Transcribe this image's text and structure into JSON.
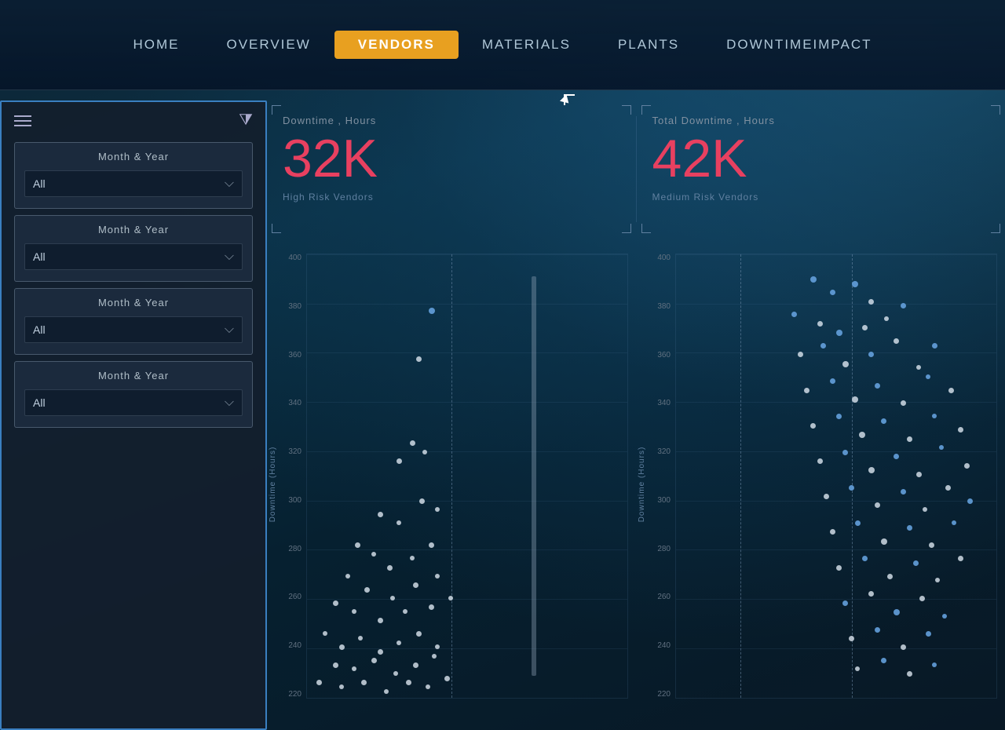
{
  "nav": {
    "items": [
      {
        "label": "Home",
        "active": false
      },
      {
        "label": "Overview",
        "active": false
      },
      {
        "label": "Vendors",
        "active": true
      },
      {
        "label": "Materials",
        "active": false
      },
      {
        "label": "Plants",
        "active": false
      },
      {
        "label": "DowntimeImpact",
        "active": false
      }
    ]
  },
  "sidebar": {
    "filters": [
      {
        "label": "Month & Year",
        "value": "All"
      },
      {
        "label": "Month & Year",
        "value": "All"
      },
      {
        "label": "Month & Year",
        "value": "All"
      },
      {
        "label": "Month & Year",
        "value": "All"
      }
    ]
  },
  "kpi": [
    {
      "label": "Downtime , Hours",
      "value": "32K",
      "sublabel": "High Risk Vendors"
    },
    {
      "label": "Total Downtime , Hours",
      "value": "42K",
      "sublabel": "Medium Risk Vendors"
    }
  ],
  "chart": {
    "y_axis_title": "Downtime (Hours)",
    "y_labels": [
      "400",
      "380",
      "360",
      "340",
      "320",
      "300",
      "280",
      "260",
      "240",
      "220"
    ],
    "placeholder": "scatter"
  },
  "colors": {
    "accent_orange": "#e8a020",
    "accent_red": "#e84060",
    "brand_blue": "#3a7fc0",
    "nav_bg": "rgba(10,30,50,0.95)"
  }
}
